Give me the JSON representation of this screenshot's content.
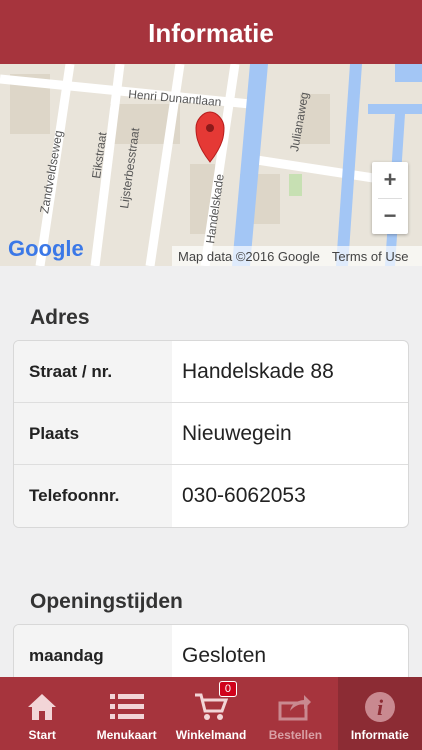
{
  "header": {
    "title": "Informatie"
  },
  "map": {
    "streets": [
      "Henri Dunantlaan",
      "Zandveldseweg",
      "Eikstraat",
      "Lijsterbesstraat",
      "Handelskade",
      "Julianaweg"
    ],
    "zoom_in": "+",
    "zoom_out": "−",
    "logo": "Google",
    "attribution": "Map data ©2016 Google",
    "terms": "Terms of Use"
  },
  "address": {
    "title": "Adres",
    "rows": [
      {
        "label": "Straat / nr.",
        "value": "Handelskade 88"
      },
      {
        "label": "Plaats",
        "value": "Nieuwegein"
      },
      {
        "label": "Telefoonnr.",
        "value": "030-6062053"
      }
    ]
  },
  "hours": {
    "title": "Openingstijden",
    "rows": [
      {
        "label": "maandag",
        "value": "Gesloten"
      }
    ]
  },
  "tabs": [
    {
      "label": "Start",
      "icon": "home-icon"
    },
    {
      "label": "Menukaart",
      "icon": "list-icon"
    },
    {
      "label": "Winkelmand",
      "icon": "cart-icon",
      "badge": "0"
    },
    {
      "label": "Bestellen",
      "icon": "share-icon"
    },
    {
      "label": "Informatie",
      "icon": "info-icon"
    }
  ],
  "colors": {
    "brand": "#a6343d",
    "active_tab": "#8c2c34",
    "badge": "#d0021b"
  }
}
